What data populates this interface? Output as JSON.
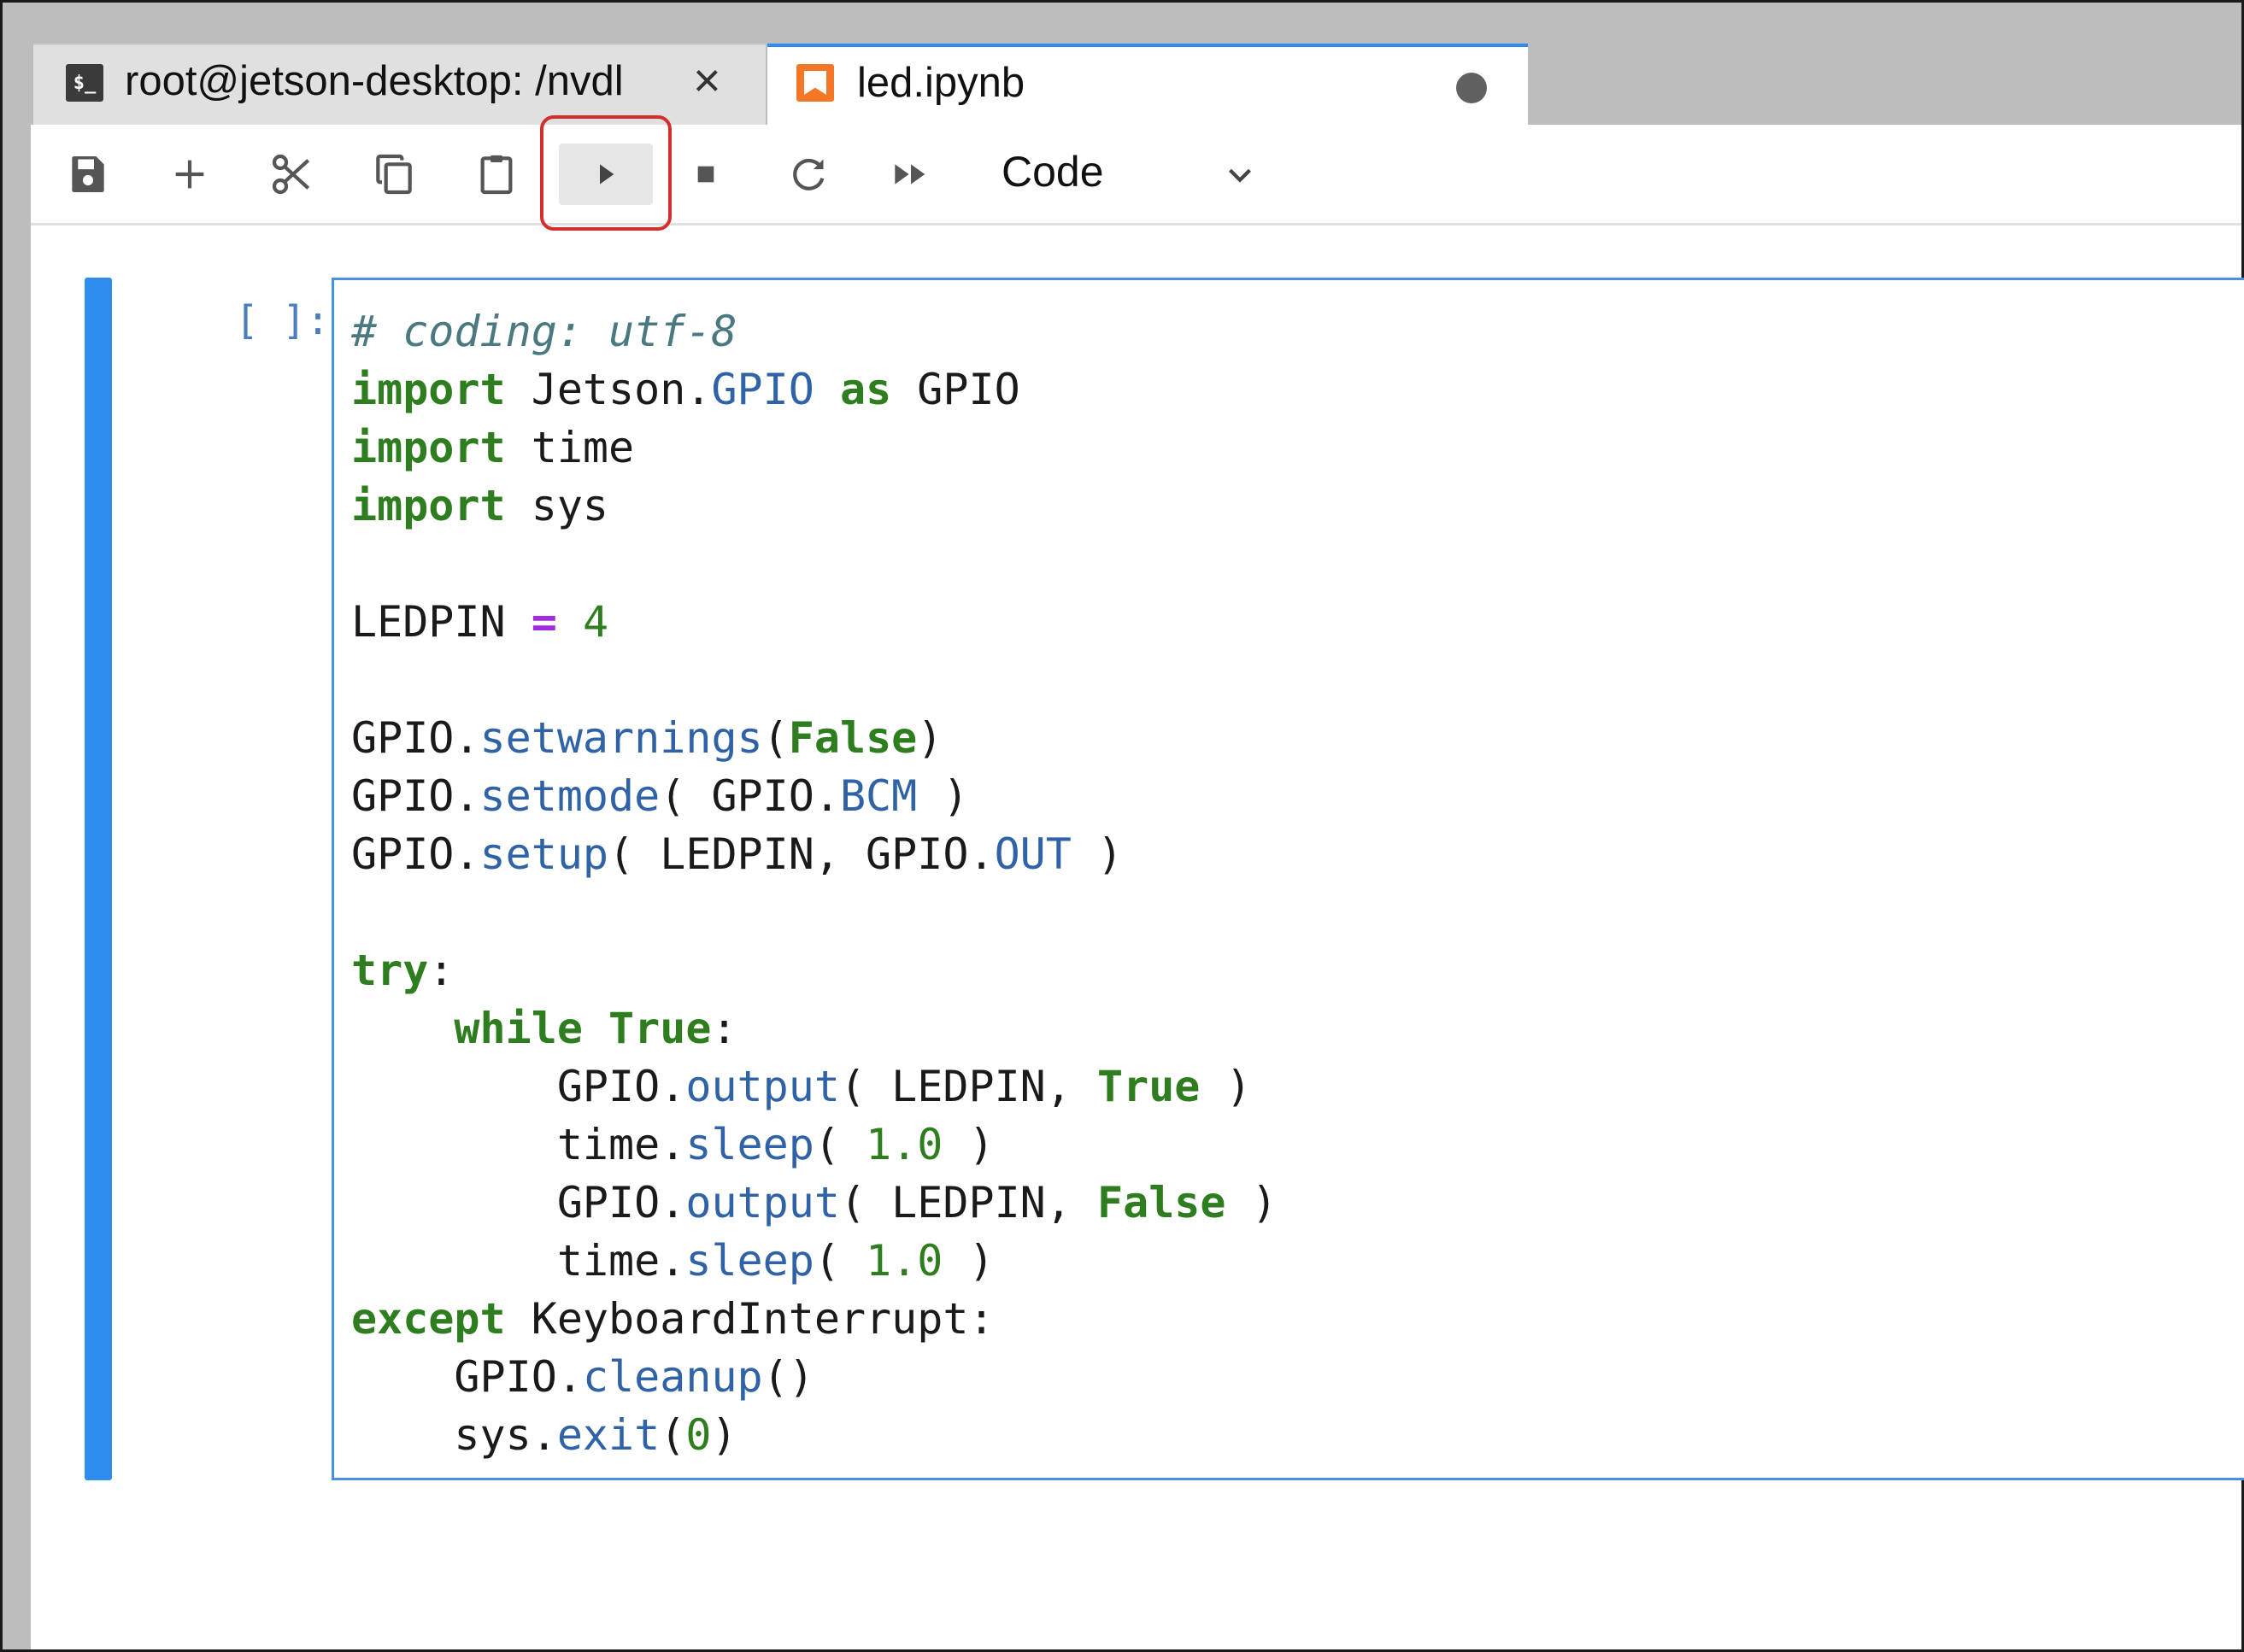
{
  "tabs": [
    {
      "label": "root@jetson-desktop: /nvdl",
      "icon": "terminal-icon",
      "active": false
    },
    {
      "label": "led.ipynb",
      "icon": "notebook-icon",
      "active": true
    }
  ],
  "toolbar": {
    "buttons": [
      "save-icon",
      "add-icon",
      "cut-icon",
      "copy-icon",
      "paste-icon",
      "run-icon",
      "stop-icon",
      "restart-icon",
      "fast-forward-icon"
    ],
    "cell_type": "Code"
  },
  "cell": {
    "prompt": "[ ]:",
    "code": [
      [
        {
          "t": "# coding: utf-8",
          "c": "cm"
        }
      ],
      [
        {
          "t": "import",
          "c": "kw"
        },
        {
          "t": " Jetson."
        },
        {
          "t": "GPIO",
          "c": "fn"
        },
        {
          "t": " "
        },
        {
          "t": "as",
          "c": "kw"
        },
        {
          "t": " GPIO"
        }
      ],
      [
        {
          "t": "import",
          "c": "kw"
        },
        {
          "t": " time"
        }
      ],
      [
        {
          "t": "import",
          "c": "kw"
        },
        {
          "t": " sys"
        }
      ],
      [],
      [
        {
          "t": "LEDPIN "
        },
        {
          "t": "=",
          "c": "op"
        },
        {
          "t": " "
        },
        {
          "t": "4",
          "c": "num"
        }
      ],
      [],
      [
        {
          "t": "GPIO."
        },
        {
          "t": "setwarnings",
          "c": "fn"
        },
        {
          "t": "("
        },
        {
          "t": "False",
          "c": "kw"
        },
        {
          "t": ")"
        }
      ],
      [
        {
          "t": "GPIO."
        },
        {
          "t": "setmode",
          "c": "fn"
        },
        {
          "t": "( GPIO."
        },
        {
          "t": "BCM",
          "c": "fn"
        },
        {
          "t": " )"
        }
      ],
      [
        {
          "t": "GPIO."
        },
        {
          "t": "setup",
          "c": "fn"
        },
        {
          "t": "( LEDPIN, GPIO."
        },
        {
          "t": "OUT",
          "c": "fn"
        },
        {
          "t": " )"
        }
      ],
      [],
      [
        {
          "t": "try",
          "c": "kw"
        },
        {
          "t": ":"
        }
      ],
      [
        {
          "t": "    "
        },
        {
          "t": "while",
          "c": "kw"
        },
        {
          "t": " "
        },
        {
          "t": "True",
          "c": "kw"
        },
        {
          "t": ":"
        }
      ],
      [
        {
          "t": "        GPIO."
        },
        {
          "t": "output",
          "c": "fn"
        },
        {
          "t": "( LEDPIN, "
        },
        {
          "t": "True",
          "c": "kw"
        },
        {
          "t": " )"
        }
      ],
      [
        {
          "t": "        time."
        },
        {
          "t": "sleep",
          "c": "fn"
        },
        {
          "t": "( "
        },
        {
          "t": "1.0",
          "c": "num"
        },
        {
          "t": " )"
        }
      ],
      [
        {
          "t": "        GPIO."
        },
        {
          "t": "output",
          "c": "fn"
        },
        {
          "t": "( LEDPIN, "
        },
        {
          "t": "False",
          "c": "kw"
        },
        {
          "t": " )"
        }
      ],
      [
        {
          "t": "        time."
        },
        {
          "t": "sleep",
          "c": "fn"
        },
        {
          "t": "( "
        },
        {
          "t": "1.0",
          "c": "num"
        },
        {
          "t": " )"
        }
      ],
      [
        {
          "t": "except",
          "c": "kw"
        },
        {
          "t": " KeyboardInterrupt:"
        }
      ],
      [
        {
          "t": "    GPIO."
        },
        {
          "t": "cleanup",
          "c": "fn"
        },
        {
          "t": "()"
        }
      ],
      [
        {
          "t": "    sys."
        },
        {
          "t": "exit",
          "c": "fn"
        },
        {
          "t": "("
        },
        {
          "t": "0",
          "c": "num"
        },
        {
          "t": ")"
        }
      ]
    ]
  },
  "colors": {
    "accent": "#2f8df0",
    "highlight": "#d32f2f",
    "keyword": "#2e7d1e",
    "function": "#2f62a6",
    "comment": "#4a7980",
    "operator": "#a22be0"
  }
}
